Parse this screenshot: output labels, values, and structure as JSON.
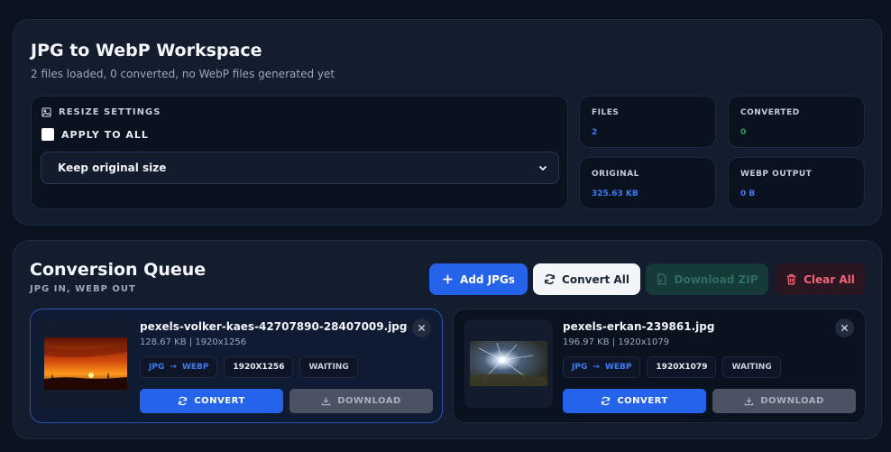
{
  "workspace": {
    "title": "JPG to WebP Workspace",
    "subtitle": "2 files loaded, 0 converted, no WebP files generated yet",
    "resize": {
      "label": "RESIZE SETTINGS",
      "icon": "image-icon",
      "apply_all_label": "APPLY TO ALL",
      "apply_all_checked": false,
      "selected_option": "Keep original size"
    },
    "stats": {
      "files": {
        "label": "FILES",
        "value": "2"
      },
      "converted": {
        "label": "CONVERTED",
        "value": "0"
      },
      "original": {
        "label": "ORIGINAL",
        "value": "325.63 KB"
      },
      "output": {
        "label": "WEBP OUTPUT",
        "value": "0 B"
      }
    }
  },
  "queue": {
    "title": "Conversion Queue",
    "subtitle": "JPG IN, WEBP OUT",
    "buttons": {
      "add": "Add JPGs",
      "convert_all": "Convert All",
      "download_zip": "Download ZIP",
      "clear_all": "Clear All"
    },
    "files": [
      {
        "name": "pexels-volker-kaes-42707890-28407009.jpg",
        "meta": "128.67 KB | 1920x1256",
        "from": "JPG",
        "to": "WEBP",
        "dimensions": "1920X1256",
        "status": "WAITING",
        "convert_label": "CONVERT",
        "download_label": "DOWNLOAD"
      },
      {
        "name": "pexels-erkan-239861.jpg",
        "meta": "196.97 KB | 1920x1079",
        "from": "JPG",
        "to": "WEBP",
        "dimensions": "1920X1079",
        "status": "WAITING",
        "convert_label": "CONVERT",
        "download_label": "DOWNLOAD"
      }
    ]
  },
  "colors": {
    "accent": "#2563eb",
    "accent_text": "#3d7bf0",
    "success": "#2e9a69",
    "danger": "#f0647a",
    "background": "#0b1220",
    "panel": "#141d2e"
  }
}
